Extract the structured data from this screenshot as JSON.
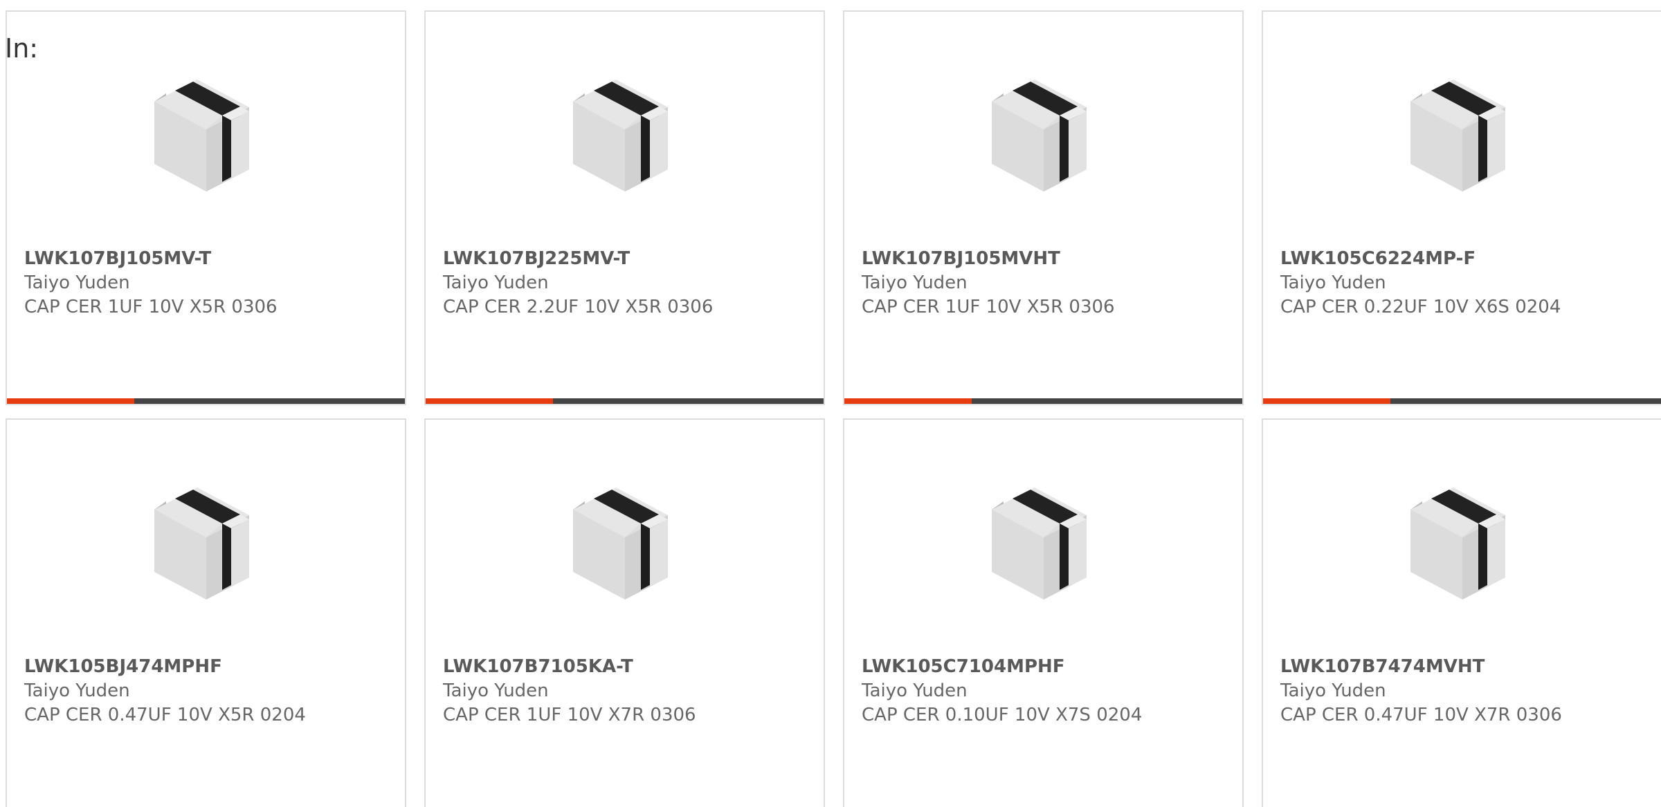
{
  "filter": {
    "in_label": "In:"
  },
  "colors": {
    "accent": "#e63c10",
    "track": "#444444",
    "border": "#dddddd",
    "text": "#666666"
  },
  "products": [
    {
      "part_number": "LWK107BJ105MV-T",
      "manufacturer": "Taiyo Yuden",
      "description": "CAP CER 1UF 10V X5R 0306",
      "image_icon": "capacitor-chip-icon",
      "progress": 0.32
    },
    {
      "part_number": "LWK107BJ225MV-T",
      "manufacturer": "Taiyo Yuden",
      "description": "CAP CER 2.2UF 10V X5R 0306",
      "image_icon": "capacitor-chip-icon",
      "progress": 0.32
    },
    {
      "part_number": "LWK107BJ105MVHT",
      "manufacturer": "Taiyo Yuden",
      "description": "CAP CER 1UF 10V X5R 0306",
      "image_icon": "capacitor-chip-icon",
      "progress": 0.32
    },
    {
      "part_number": "LWK105C6224MP-F",
      "manufacturer": "Taiyo Yuden",
      "description": "CAP CER 0.22UF 10V X6S 0204",
      "image_icon": "capacitor-chip-icon",
      "progress": 0.32
    },
    {
      "part_number": "LWK105BJ474MPHF",
      "manufacturer": "Taiyo Yuden",
      "description": "CAP CER 0.47UF 10V X5R 0204",
      "image_icon": "capacitor-chip-icon"
    },
    {
      "part_number": "LWK107B7105KA-T",
      "manufacturer": "Taiyo Yuden",
      "description": "CAP CER 1UF 10V X7R 0306",
      "image_icon": "capacitor-chip-icon"
    },
    {
      "part_number": "LWK105C7104MPHF",
      "manufacturer": "Taiyo Yuden",
      "description": "CAP CER 0.10UF 10V X7S 0204",
      "image_icon": "capacitor-chip-icon"
    },
    {
      "part_number": "LWK107B7474MVHT",
      "manufacturer": "Taiyo Yuden",
      "description": "CAP CER 0.47UF 10V X7R 0306",
      "image_icon": "capacitor-chip-icon"
    }
  ]
}
